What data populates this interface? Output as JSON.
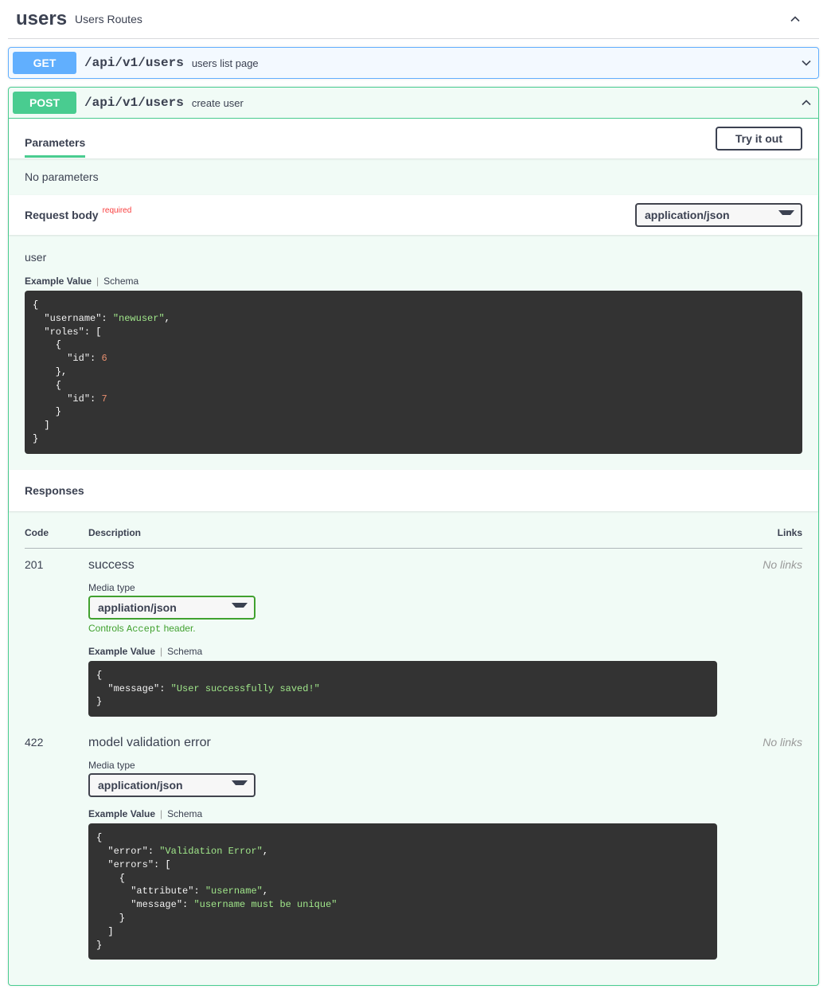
{
  "tag": {
    "name": "users",
    "description": "Users Routes"
  },
  "ops": {
    "get": {
      "method": "GET",
      "path": "/api/v1/users",
      "summary": "users list page"
    },
    "post": {
      "method": "POST",
      "path": "/api/v1/users",
      "summary": "create user"
    }
  },
  "labels": {
    "parameters": "Parameters",
    "try_it_out": "Try it out",
    "no_parameters": "No parameters",
    "request_body": "Request body",
    "required": "required",
    "example_value": "Example Value",
    "schema": "Schema",
    "responses": "Responses",
    "code": "Code",
    "description": "Description",
    "links": "Links",
    "no_links": "No links",
    "media_type": "Media type",
    "controls_prefix": "Controls ",
    "controls_code": "Accept",
    "controls_suffix": " header."
  },
  "request_body": {
    "content_type": "application/json",
    "description": "user",
    "example_html": "{\n  <span class=\"tok-key\">\"username\"</span>: <span class=\"tok-str\">\"newuser\"</span>,\n  <span class=\"tok-key\">\"roles\"</span>: [\n    {\n      <span class=\"tok-key\">\"id\"</span>: <span class=\"tok-num\">6</span>\n    },\n    {\n      <span class=\"tok-key\">\"id\"</span>: <span class=\"tok-num\">7</span>\n    }\n  ]\n}"
  },
  "responses": [
    {
      "code": "201",
      "description": "success",
      "media_type": "appliation/json",
      "green_border": true,
      "show_controls": true,
      "example_html": "{\n  <span class=\"tok-key\">\"message\"</span>: <span class=\"tok-str\">\"User successfully saved!\"</span>\n}"
    },
    {
      "code": "422",
      "description": "model validation error",
      "media_type": "application/json",
      "green_border": false,
      "show_controls": false,
      "example_html": "{\n  <span class=\"tok-key\">\"error\"</span>: <span class=\"tok-str\">\"Validation Error\"</span>,\n  <span class=\"tok-key\">\"errors\"</span>: [\n    {\n      <span class=\"tok-key\">\"attribute\"</span>: <span class=\"tok-str\">\"username\"</span>,\n      <span class=\"tok-key\">\"message\"</span>: <span class=\"tok-str\">\"username must be unique\"</span>\n    }\n  ]\n}"
    }
  ]
}
